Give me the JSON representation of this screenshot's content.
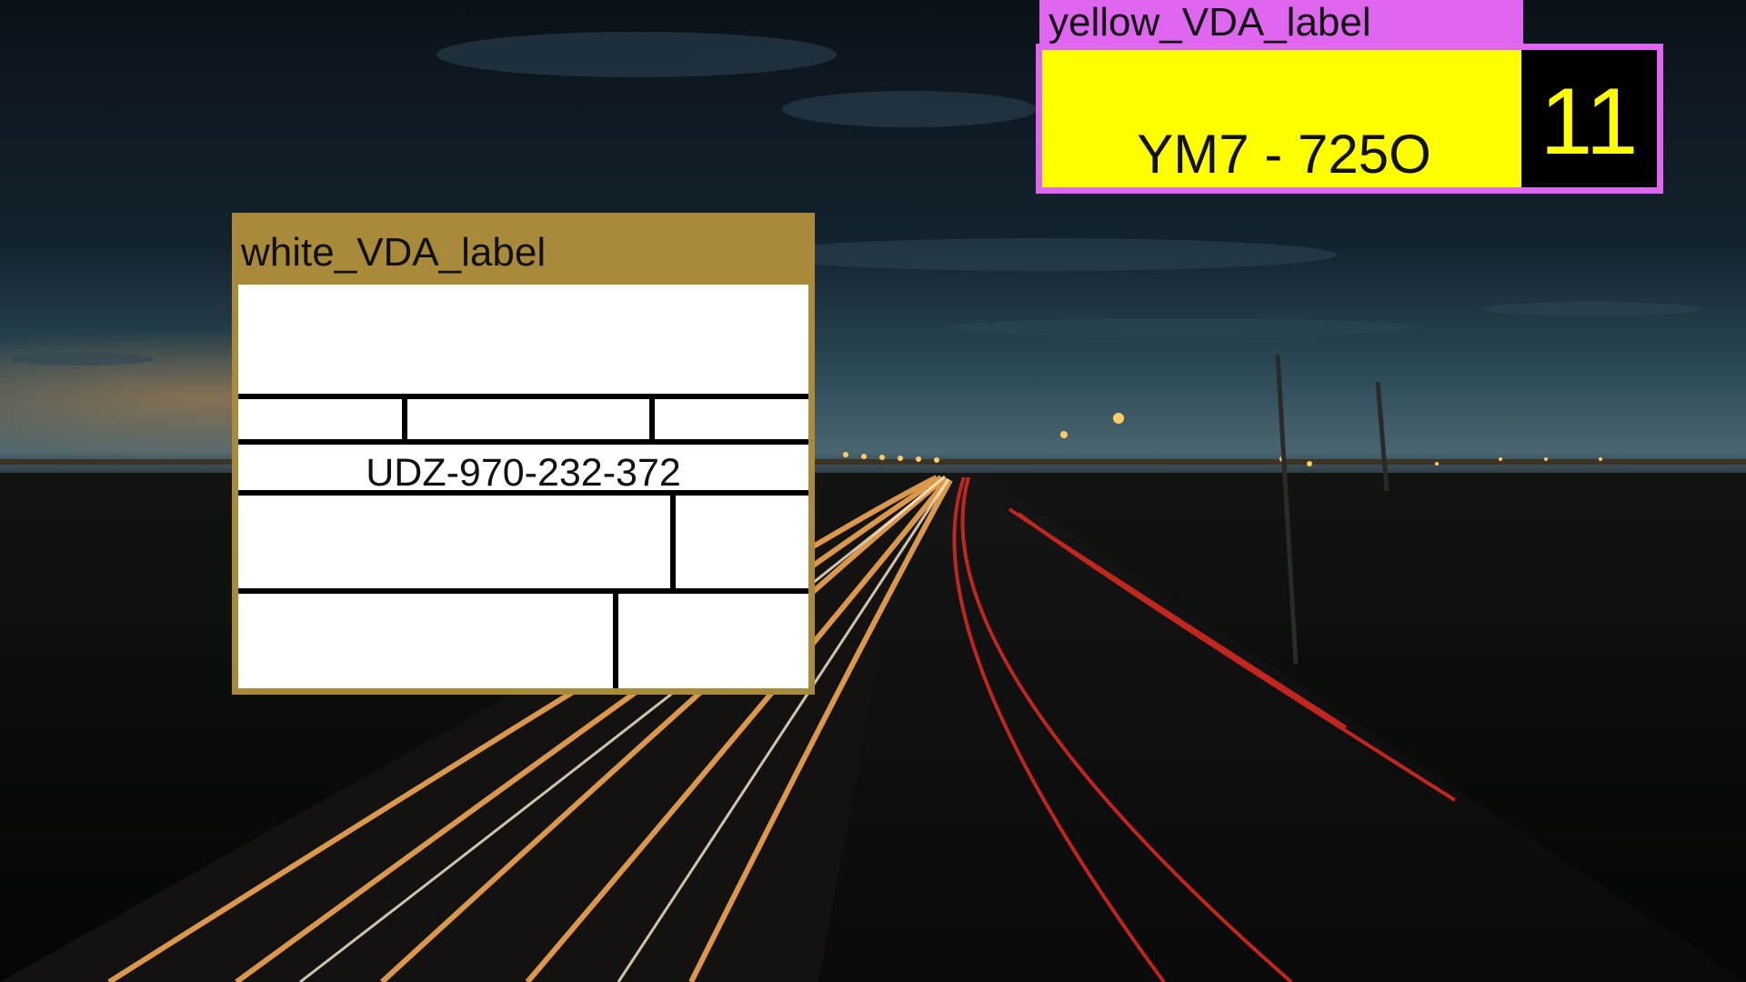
{
  "labels": {
    "white": {
      "tag": "white_VDA_label",
      "code": "UDZ-970-232-372",
      "color": "#a98a3a"
    },
    "yellow": {
      "tag": "yellow_VDA_label",
      "plate": "YM7 - 725O",
      "count": "11",
      "color": "#df66ef",
      "fill": "#ffff00"
    }
  },
  "background": {
    "description_icon": "night-highway-photo"
  }
}
